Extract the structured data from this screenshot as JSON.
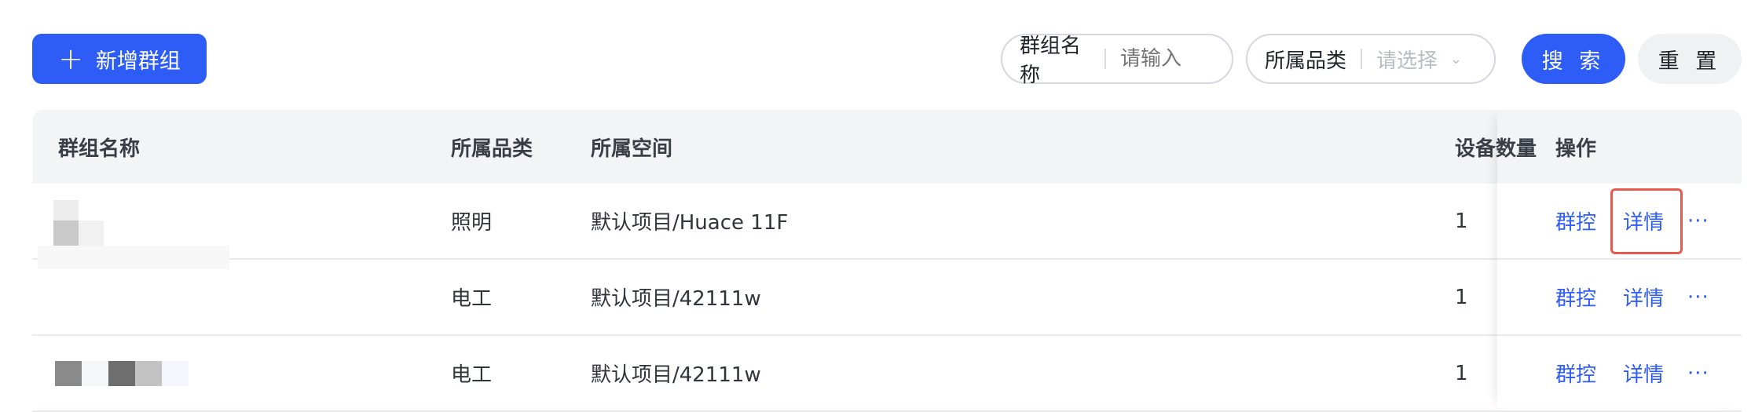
{
  "toolbar": {
    "add_label": "新增群组",
    "search_label": "搜 索",
    "reset_label": "重 置"
  },
  "filters": {
    "group_name": {
      "label": "群组名称",
      "placeholder": "请输入"
    },
    "category": {
      "label": "所属品类",
      "placeholder": "请选择"
    }
  },
  "table": {
    "headers": {
      "name": "群组名称",
      "category": "所属品类",
      "space": "所属空间",
      "count": "设备数量",
      "ops": "操作"
    },
    "rows": [
      {
        "name": "",
        "category": "照明",
        "space": "默认项目/Huace 11F",
        "count": "1"
      },
      {
        "name": "",
        "category": "电工",
        "space": "默认项目/42111w",
        "count": "1"
      },
      {
        "name": "",
        "category": "电工",
        "space": "默认项目/42111w",
        "count": "1"
      }
    ],
    "ops": {
      "control": "群控",
      "detail": "详情",
      "more": "···"
    }
  }
}
